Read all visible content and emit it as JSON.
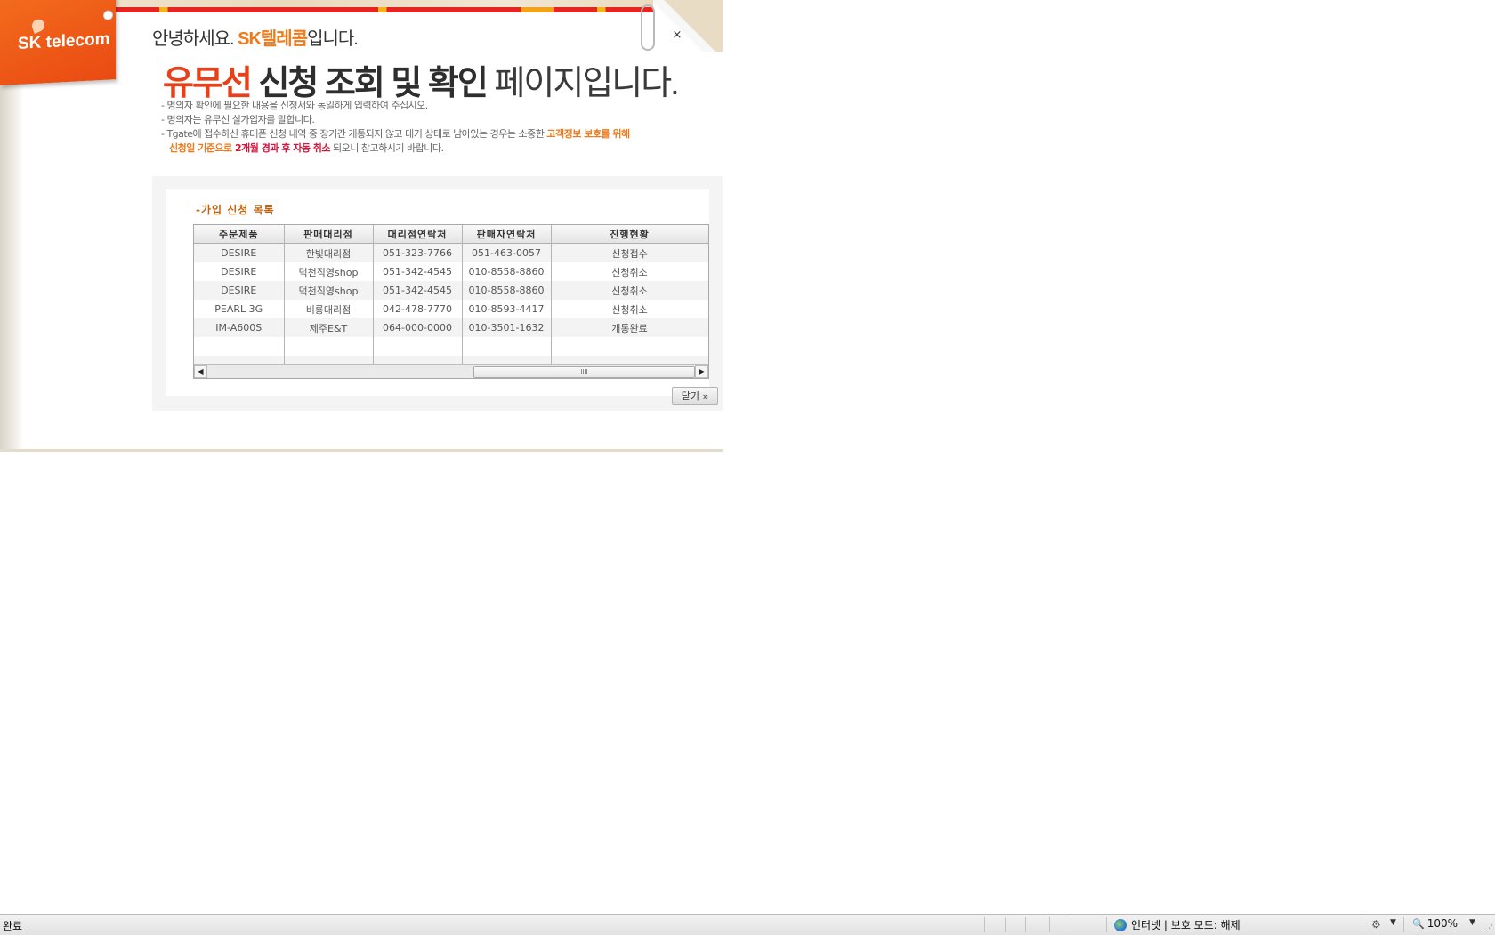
{
  "header": {
    "logo_text": "SK telecom",
    "close_symbol": "×",
    "greeting_prefix": "안녕하세요.",
    "greeting_brand": "SK텔레콤",
    "greeting_suffix": "입니다.",
    "headline_accent": "유무선",
    "headline_bold": "신청 조회 및 확인",
    "headline_light": "페이지입니다."
  },
  "notes": {
    "line1": "- 명의자 확인에 필요한 내용을 신청서와 동일하게 입력하여 주십시오.",
    "line2": "- 명의자는 유무선 실가입자를 말합니다.",
    "line3_a": "- Tgate에 접수하신 휴대폰 신청 내역 중 장기간 개통되지 않고 대기 상태로 남아있는 경우는 소중한 ",
    "line3_b": "고객정보 보호를 위해",
    "line4_a": "신청일 기준으로 ",
    "line4_b": "2개월 경과 후 자동 취소",
    "line4_c": " 되오니 참고하시기 바랍니다."
  },
  "list": {
    "title": "-가입 신청 목록",
    "columns": [
      "주문제품",
      "판매대리점",
      "대리점연락처",
      "판매자연락처",
      "진행현황"
    ],
    "rows": [
      [
        "DESIRE",
        "한빛대리점",
        "051-323-7766",
        "051-463-0057",
        "신청접수"
      ],
      [
        "DESIRE",
        "덕천직영shop",
        "051-342-4545",
        "010-8558-8860",
        "신청취소"
      ],
      [
        "DESIRE",
        "덕천직영shop",
        "051-342-4545",
        "010-8558-8860",
        "신청취소"
      ],
      [
        "PEARL 3G",
        "비룡대리점",
        "042-478-7770",
        "010-8593-4417",
        "신청취소"
      ],
      [
        "IM-A600S",
        "제주E&T",
        "064-000-0000",
        "010-3501-1632",
        "개통완료"
      ]
    ],
    "scroll_left": "◀",
    "scroll_right": "▶",
    "scroll_grip": "IIII",
    "close_button": "닫기 »"
  },
  "statusbar": {
    "status": "완료",
    "zone": "인터넷 | 보호 모드: 해제",
    "zoom": "100%",
    "dropdown_arrow": "▼"
  },
  "colors": {
    "brand_orange": "#ef7a1a",
    "accent_red": "#e8411a",
    "notice_red": "#d4153c"
  }
}
